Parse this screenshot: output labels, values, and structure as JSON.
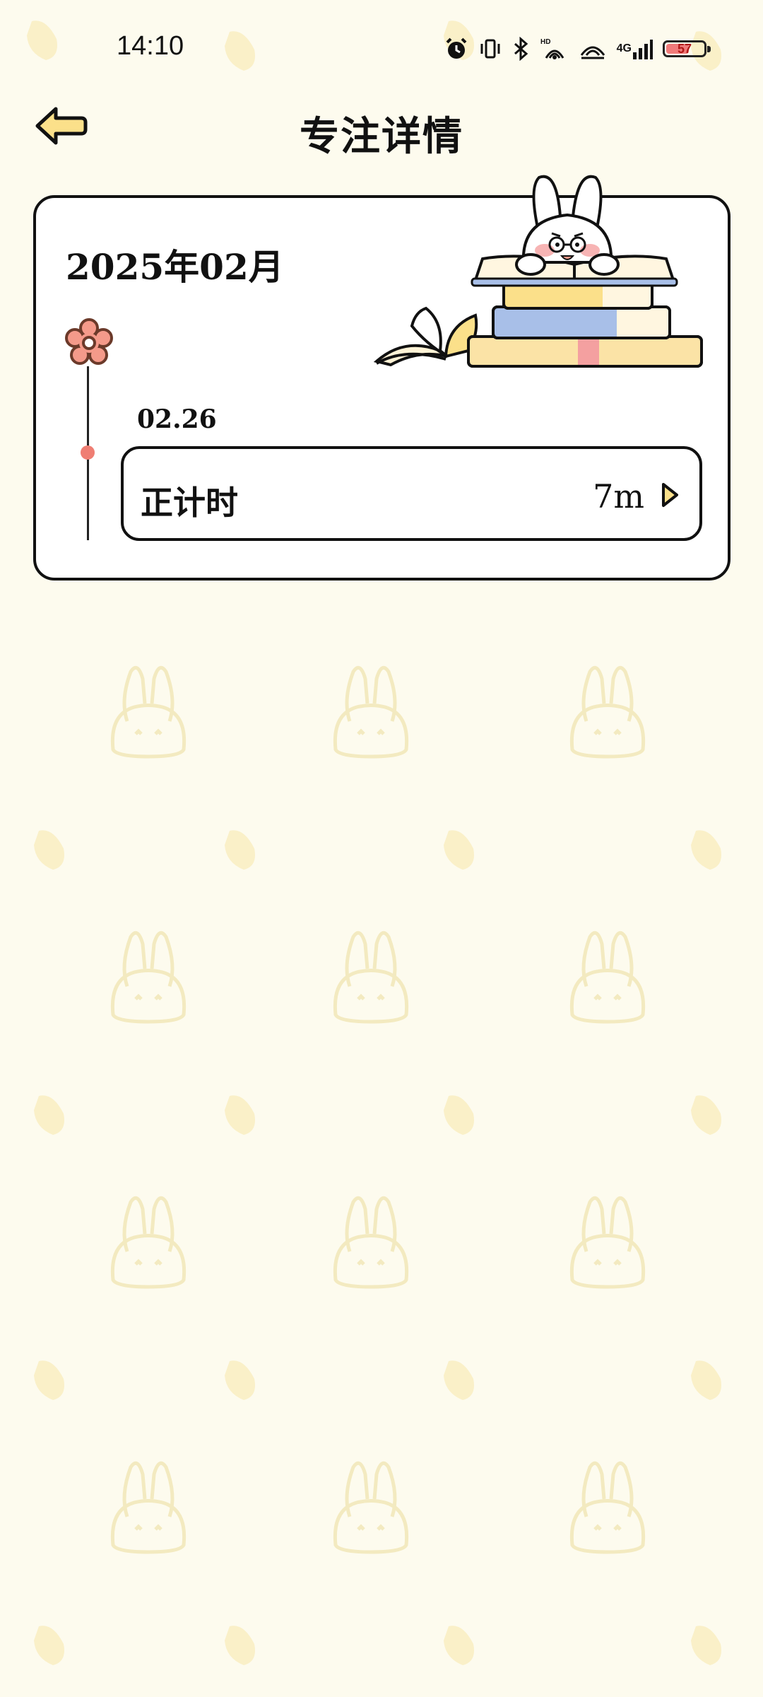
{
  "status_bar": {
    "time": "14:10",
    "network_label": "4G",
    "battery_level": "57"
  },
  "header": {
    "title": "专注详情",
    "back_icon": "arrow-left-icon"
  },
  "card": {
    "month": "2025年02月",
    "illustration": "bunny-reading-books",
    "records": [
      {
        "date": "02.26",
        "type": "正计时",
        "duration": "7m"
      }
    ]
  },
  "colors": {
    "background": "#fdfbee",
    "pattern": "#f7efc6",
    "accent_yellow": "#fbe08a",
    "timeline_dot": "#ef7e73",
    "flower": "#f49a8a"
  }
}
